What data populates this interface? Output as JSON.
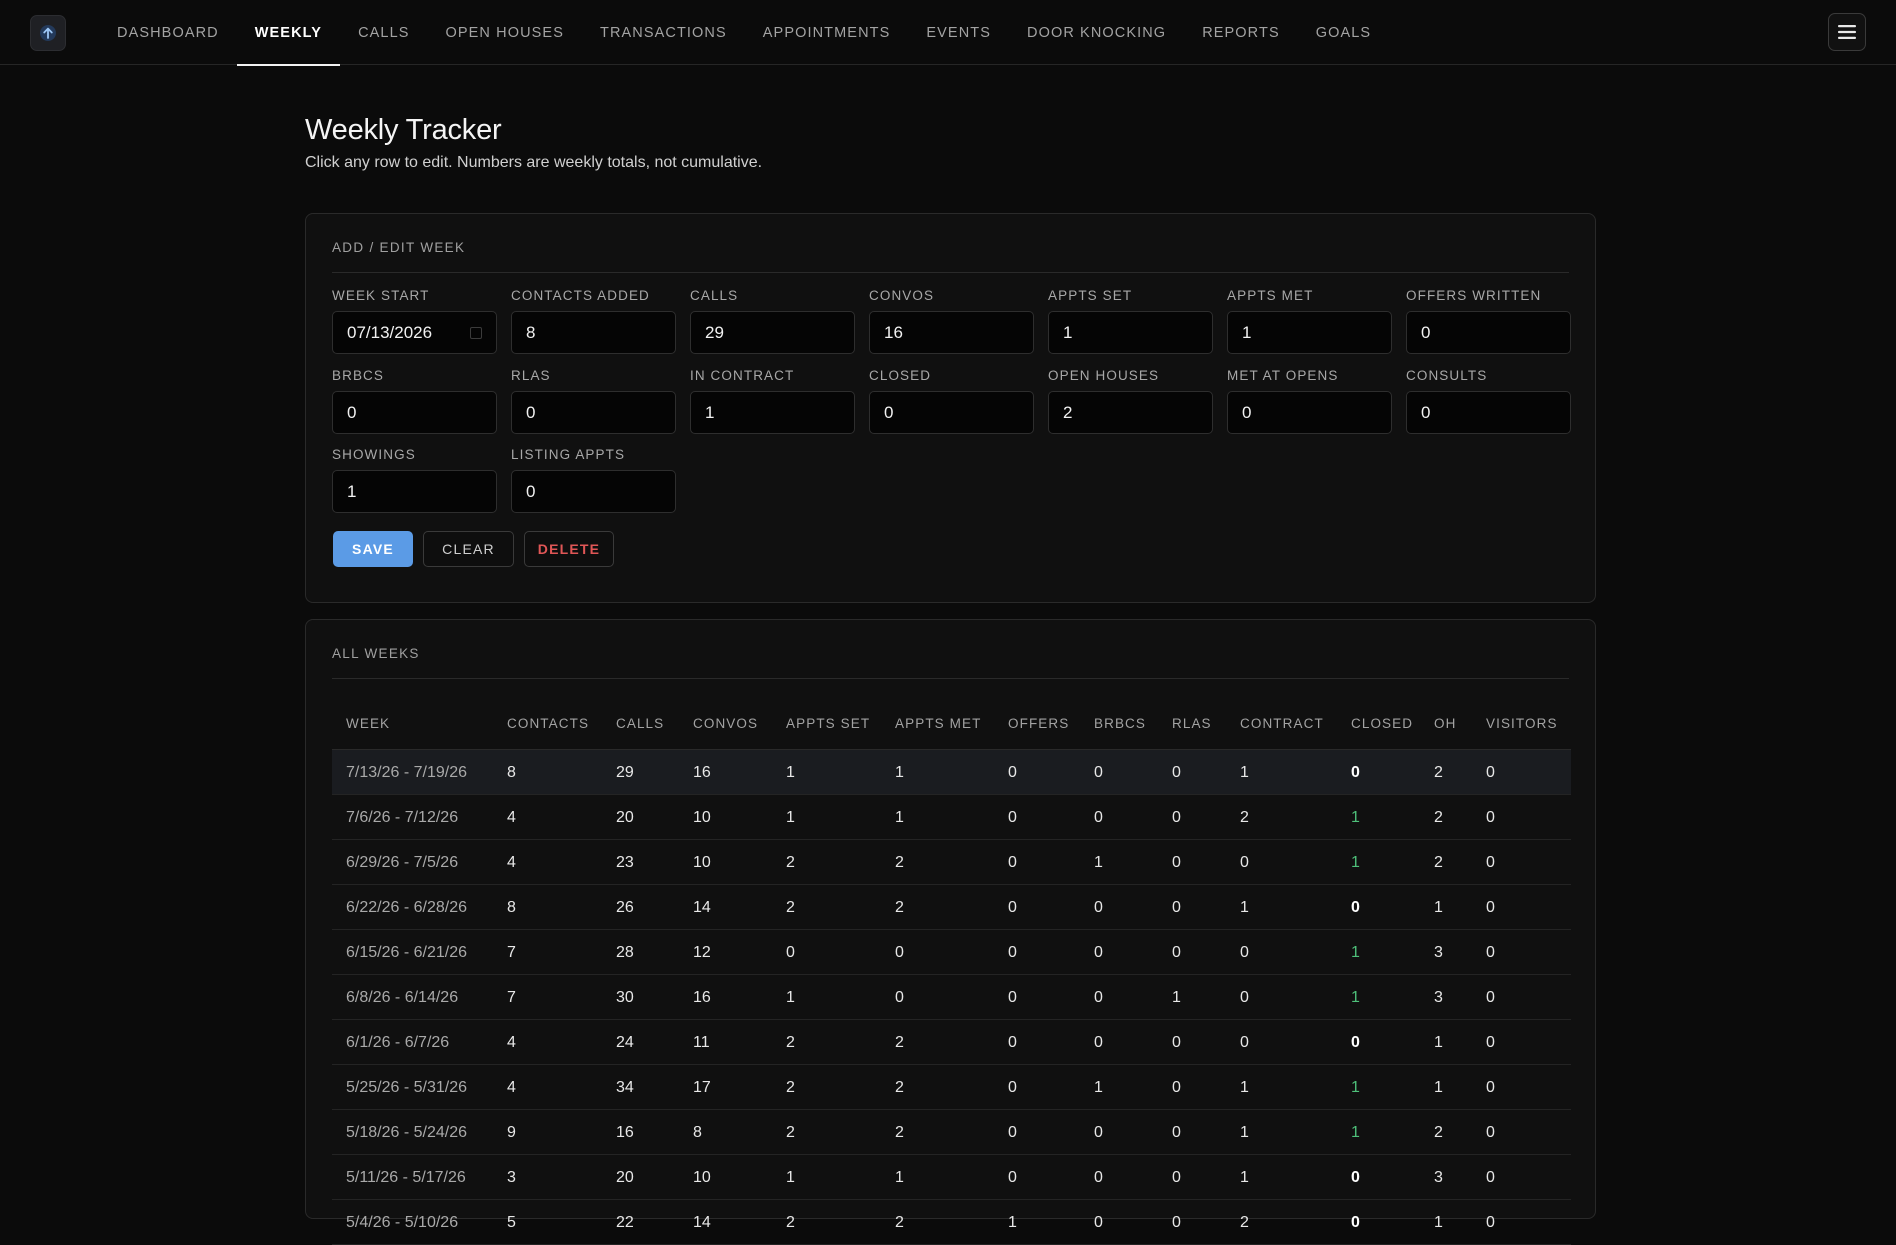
{
  "nav": {
    "logo_icon": "arrow-up-icon",
    "tabs": [
      {
        "label": "DASHBOARD",
        "active": false
      },
      {
        "label": "WEEKLY",
        "active": true
      },
      {
        "label": "CALLS",
        "active": false
      },
      {
        "label": "OPEN HOUSES",
        "active": false
      },
      {
        "label": "TRANSACTIONS",
        "active": false
      },
      {
        "label": "APPOINTMENTS",
        "active": false
      },
      {
        "label": "EVENTS",
        "active": false
      },
      {
        "label": "DOOR KNOCKING",
        "active": false
      },
      {
        "label": "REPORTS",
        "active": false
      },
      {
        "label": "GOALS",
        "active": false
      }
    ],
    "menu_icon": "hamburger-menu-icon"
  },
  "page": {
    "title": "Weekly Tracker",
    "subtitle": "Click any row to edit. Numbers are weekly totals, not cumulative."
  },
  "form": {
    "heading": "ADD / EDIT WEEK",
    "fields": [
      {
        "label": "WEEK START",
        "value": "07/13/2026"
      },
      {
        "label": "CONTACTS ADDED",
        "value": "8"
      },
      {
        "label": "CALLS",
        "value": "29"
      },
      {
        "label": "CONVOS",
        "value": "16"
      },
      {
        "label": "APPTS SET",
        "value": "1"
      },
      {
        "label": "APPTS MET",
        "value": "1"
      },
      {
        "label": "OFFERS WRITTEN",
        "value": "0"
      },
      {
        "label": "BRBCS",
        "value": "0"
      },
      {
        "label": "RLAS",
        "value": "0"
      },
      {
        "label": "IN CONTRACT",
        "value": "1"
      },
      {
        "label": "CLOSED",
        "value": "0"
      },
      {
        "label": "OPEN HOUSES",
        "value": "2"
      },
      {
        "label": "MET AT OPENS",
        "value": "0"
      },
      {
        "label": "CONSULTS",
        "value": "0"
      },
      {
        "label": "SHOWINGS",
        "value": "1"
      },
      {
        "label": "LISTING APPTS",
        "value": "0"
      }
    ],
    "save_label": "SAVE",
    "clear_label": "CLEAR",
    "delete_label": "DELETE"
  },
  "table": {
    "heading": "ALL WEEKS",
    "columns": [
      "WEEK",
      "CONTACTS",
      "CALLS",
      "CONVOS",
      "APPTS SET",
      "APPTS MET",
      "OFFERS",
      "BRBCS",
      "RLAS",
      "CONTRACT",
      "CLOSED",
      "OH",
      "VISITORS"
    ],
    "rows": [
      [
        "7/13/26 - 7/19/26",
        "8",
        "29",
        "16",
        "1",
        "1",
        "0",
        "0",
        "0",
        "1",
        "0",
        "2",
        "0"
      ],
      [
        "7/6/26 - 7/12/26",
        "4",
        "20",
        "10",
        "1",
        "1",
        "0",
        "0",
        "0",
        "2",
        "1",
        "2",
        "0"
      ],
      [
        "6/29/26 - 7/5/26",
        "4",
        "23",
        "10",
        "2",
        "2",
        "0",
        "1",
        "0",
        "0",
        "1",
        "2",
        "0"
      ],
      [
        "6/22/26 - 6/28/26",
        "8",
        "26",
        "14",
        "2",
        "2",
        "0",
        "0",
        "0",
        "1",
        "0",
        "1",
        "0"
      ],
      [
        "6/15/26 - 6/21/26",
        "7",
        "28",
        "12",
        "0",
        "0",
        "0",
        "0",
        "0",
        "0",
        "1",
        "3",
        "0"
      ],
      [
        "6/8/26 - 6/14/26",
        "7",
        "30",
        "16",
        "1",
        "0",
        "0",
        "0",
        "1",
        "0",
        "1",
        "3",
        "0"
      ],
      [
        "6/1/26 - 6/7/26",
        "4",
        "24",
        "11",
        "2",
        "2",
        "0",
        "0",
        "0",
        "0",
        "0",
        "1",
        "0"
      ],
      [
        "5/25/26 - 5/31/26",
        "4",
        "34",
        "17",
        "2",
        "2",
        "0",
        "1",
        "0",
        "1",
        "1",
        "1",
        "0"
      ],
      [
        "5/18/26 - 5/24/26",
        "9",
        "16",
        "8",
        "2",
        "2",
        "0",
        "0",
        "0",
        "1",
        "1",
        "2",
        "0"
      ],
      [
        "5/11/26 - 5/17/26",
        "3",
        "20",
        "10",
        "1",
        "1",
        "0",
        "0",
        "0",
        "1",
        "0",
        "3",
        "0"
      ],
      [
        "5/4/26 - 5/10/26",
        "5",
        "22",
        "14",
        "2",
        "2",
        "1",
        "0",
        "0",
        "2",
        "0",
        "1",
        "0"
      ]
    ],
    "selected_row": 0
  }
}
